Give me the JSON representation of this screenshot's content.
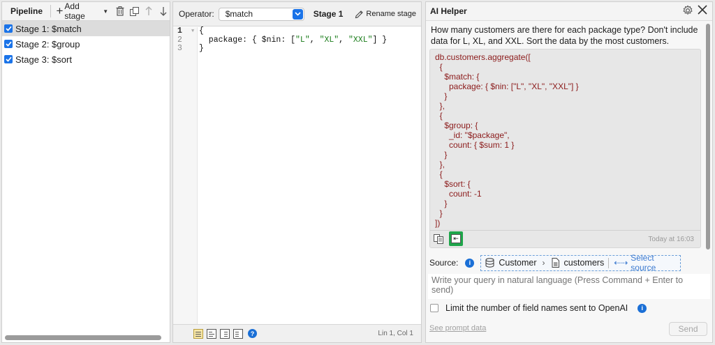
{
  "pipeline": {
    "title": "Pipeline",
    "add_stage_label": "Add stage",
    "stages": [
      {
        "label": "Stage 1: $match",
        "checked": true,
        "selected": true
      },
      {
        "label": "Stage 2: $group",
        "checked": true,
        "selected": false
      },
      {
        "label": "Stage 3: $sort",
        "checked": true,
        "selected": false
      }
    ]
  },
  "editor": {
    "operator_label": "Operator:",
    "operator_value": "$match",
    "stage_title": "Stage 1",
    "rename_label": "Rename stage",
    "line_numbers": [
      "1",
      "2",
      "3"
    ],
    "code_lines": [
      "{",
      "  package: { $nin: [\"L\", \"XL\", \"XXL\"] }",
      "}"
    ],
    "cursor_position": "Lin 1, Col 1",
    "help_symbol": "?"
  },
  "ai_helper": {
    "title": "AI Helper",
    "question": "How many customers are there for each package type? Don't include data for L, XL, and XXL. Sort the data by the most customers.",
    "answer_code": "db.customers.aggregate([\n  {\n    $match: {\n      package: { $nin: [\"L\", \"XL\", \"XXL\"] }\n    }\n  },\n  {\n    $group: {\n      _id: \"$package\",\n      count: { $sum: 1 }\n    }\n  },\n  {\n    $sort: {\n      count: -1\n    }\n  }\n])",
    "timestamp": "Today at 16:03",
    "source_label": "Source:",
    "source_database": "Customer",
    "source_collection": "customers",
    "select_source_label": "Select source",
    "query_placeholder": "Write your query in natural language (Press Command + Enter to send)",
    "limit_label": "Limit the number of field names sent to OpenAI",
    "see_prompt_label": "See prompt data",
    "send_label": "Send",
    "info_symbol": "i"
  },
  "colors": {
    "accent": "#1a73e8",
    "insert_button": "#1ea54a",
    "code_text": "#8b1a1a",
    "string_green": "#1b7d1b"
  }
}
